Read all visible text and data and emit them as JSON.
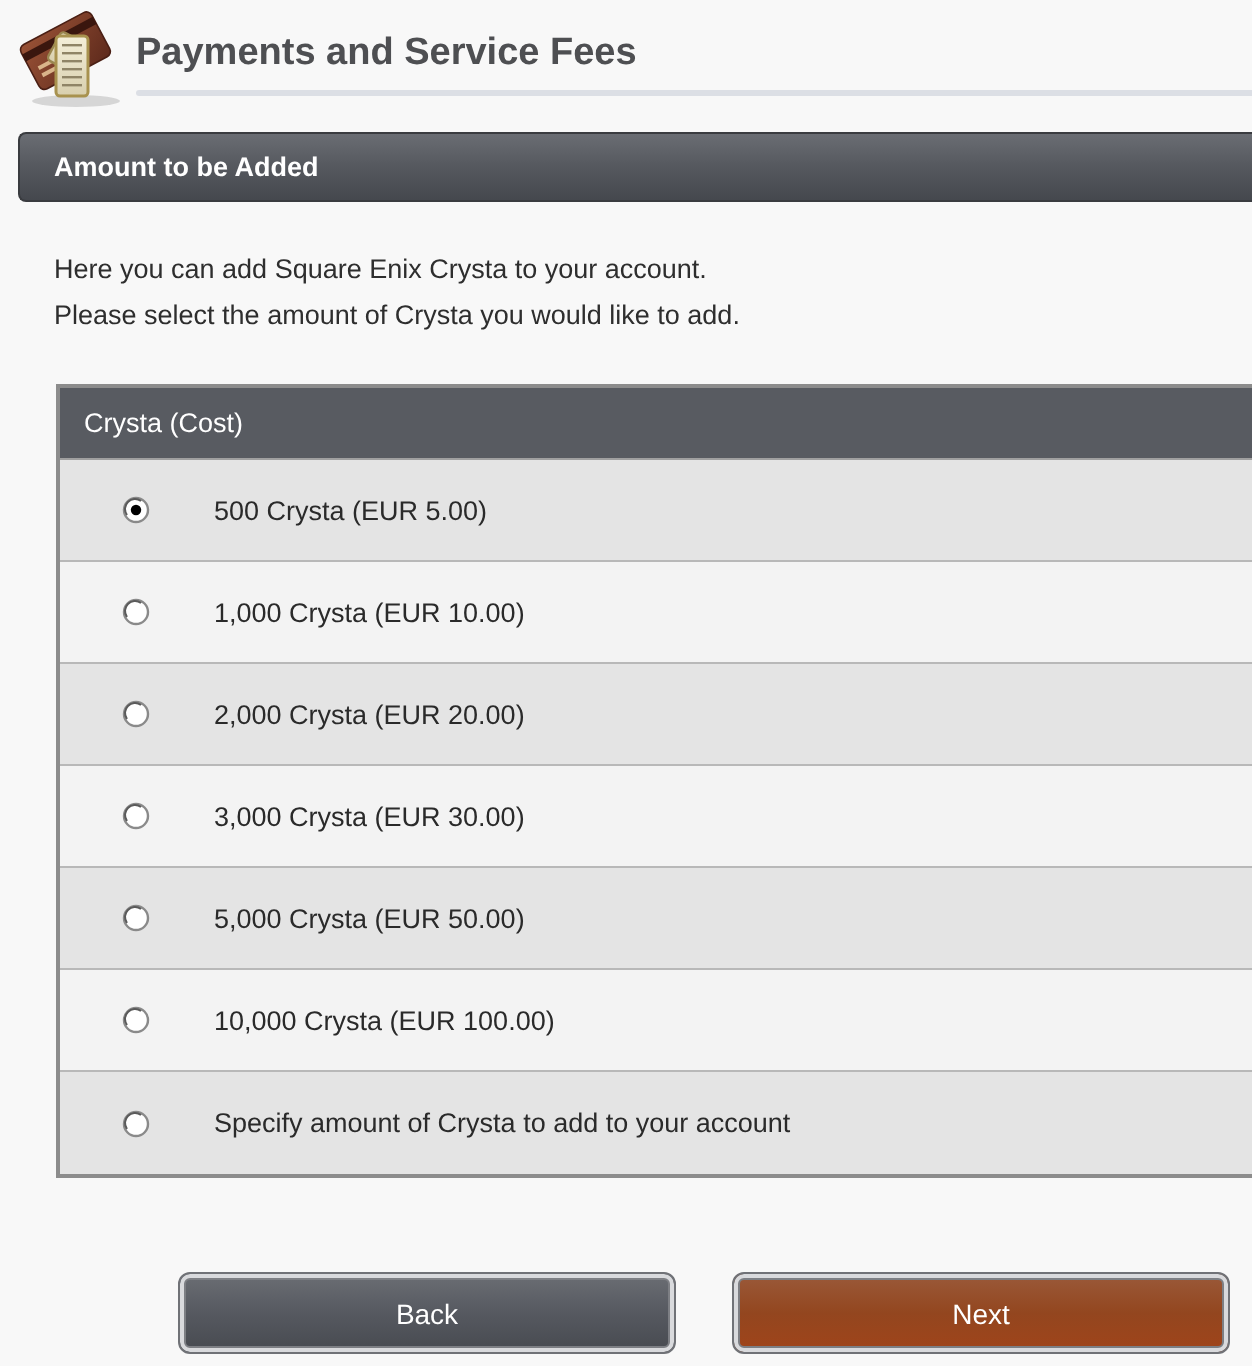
{
  "page": {
    "title": "Payments and Service Fees"
  },
  "section": {
    "title": "Amount to be Added"
  },
  "intro": [
    "Here you can add Square Enix Crysta to your account.",
    "Please select the amount of Crysta you would like to add."
  ],
  "table": {
    "columns": [
      "Crysta (Cost)"
    ],
    "options": [
      {
        "label": "500 Crysta (EUR 5.00)",
        "selected": true
      },
      {
        "label": "1,000 Crysta (EUR 10.00)",
        "selected": false
      },
      {
        "label": "2,000 Crysta (EUR 20.00)",
        "selected": false
      },
      {
        "label": "3,000 Crysta (EUR 30.00)",
        "selected": false
      },
      {
        "label": "5,000 Crysta (EUR 50.00)",
        "selected": false
      },
      {
        "label": "10,000 Crysta (EUR 100.00)",
        "selected": false
      },
      {
        "label": "Specify amount of Crysta to add to your account",
        "selected": false
      }
    ]
  },
  "buttons": [
    {
      "label": "Back",
      "kind": "secondary"
    },
    {
      "label": "Next",
      "kind": "primary"
    }
  ]
}
